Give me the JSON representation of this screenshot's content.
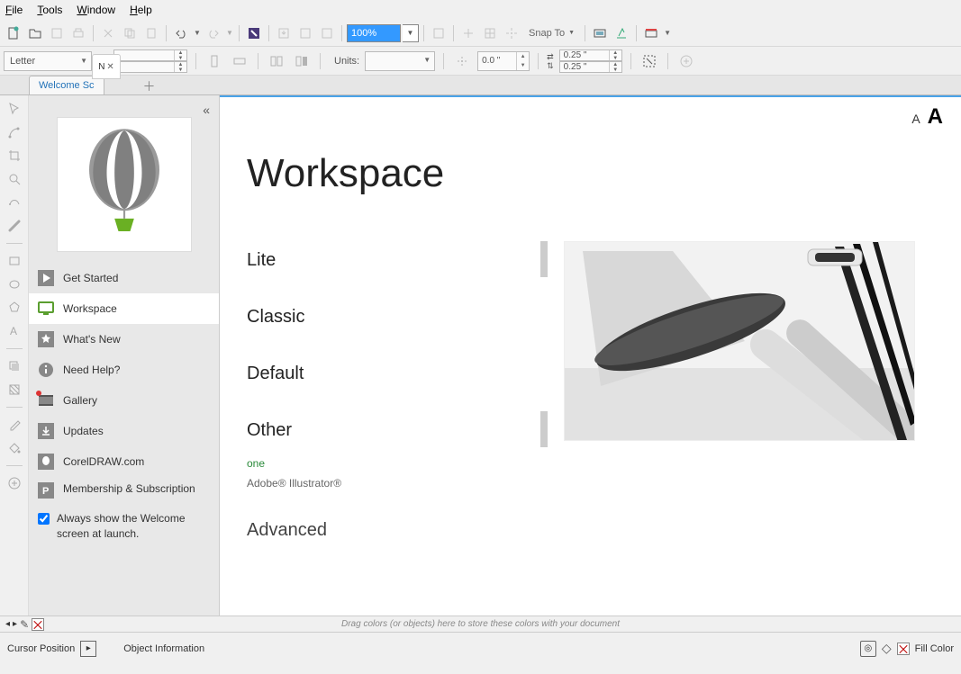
{
  "menu": {
    "file": "File",
    "tools": "Tools",
    "window": "Window",
    "help": "Help"
  },
  "toolbar": {
    "zoom": "100%",
    "snap": "Snap To"
  },
  "propbar": {
    "page": "Letter",
    "units_label": "Units:",
    "xy": "0.0 \"",
    "nudge1": "0.25 \"",
    "nudge2": "0.25 \""
  },
  "tabs": {
    "welcome": "Welcome Sc",
    "doc": "N"
  },
  "sidebar": {
    "items": [
      {
        "label": "Get Started"
      },
      {
        "label": "Workspace"
      },
      {
        "label": "What's New"
      },
      {
        "label": "Need Help?"
      },
      {
        "label": "Gallery"
      },
      {
        "label": "Updates"
      },
      {
        "label": "CorelDRAW.com"
      },
      {
        "label": "Membership & Subscription"
      }
    ],
    "checkbox": "Always show the Welcome screen at launch."
  },
  "content": {
    "title": "Workspace",
    "cats": {
      "lite": "Lite",
      "classic": "Classic",
      "default": "Default",
      "other": "Other",
      "advanced": "Advanced"
    },
    "subs": {
      "one": "one",
      "ai": "Adobe® Illustrator®"
    }
  },
  "colorbar": {
    "hint": "Drag colors (or objects) here to store these colors with your document"
  },
  "status": {
    "cursor": "Cursor Position",
    "obj": "Object Information",
    "fill": "Fill Color"
  }
}
